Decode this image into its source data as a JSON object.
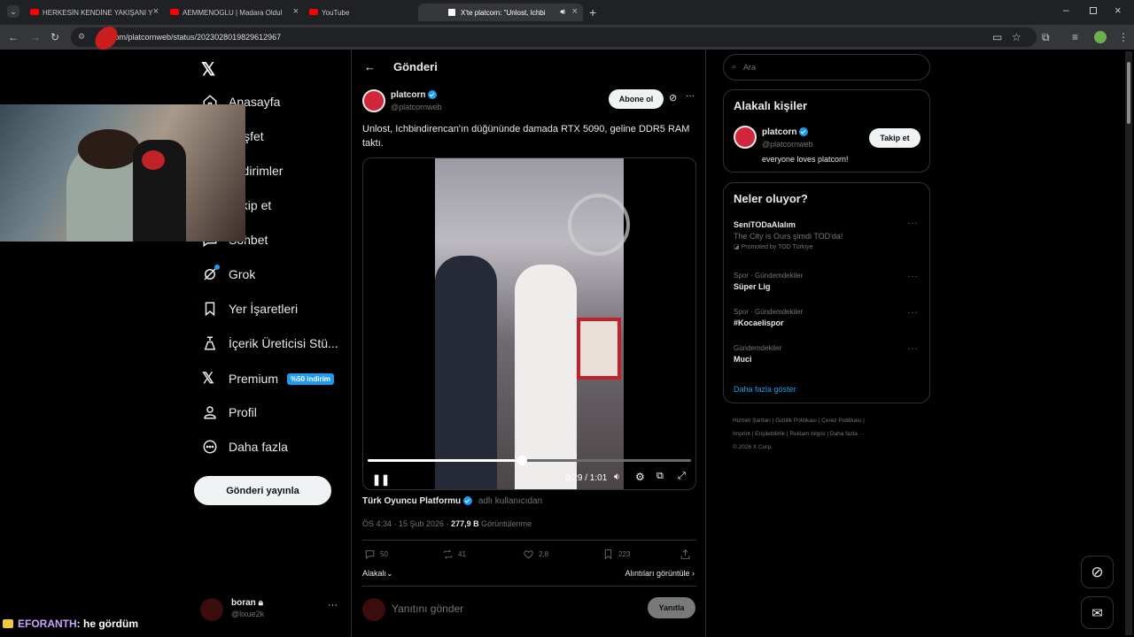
{
  "browser": {
    "tabs": [
      {
        "title": "HERKESİN KENDİNE YAKIŞANI Y"
      },
      {
        "title": "AEMMENOGLU | Madara Oldul"
      },
      {
        "title": "YouTube"
      },
      {
        "title": "X'te platcorn: \"Unlost, Ichbi"
      }
    ],
    "url": "x.com/platcornweb/status/2023028019829612967"
  },
  "sidebar": {
    "items": [
      {
        "label": "Anasayfa",
        "icon": "home-icon"
      },
      {
        "label": "Keşfet",
        "icon": "search-icon"
      },
      {
        "label": "Bildirimler",
        "icon": "bell-icon"
      },
      {
        "label": "Takip et",
        "icon": "follow-icon"
      },
      {
        "label": "Sohbet",
        "icon": "chat-icon"
      },
      {
        "label": "Grok",
        "icon": "grok-icon"
      },
      {
        "label": "Yer İşaretleri",
        "icon": "bookmark-icon"
      },
      {
        "label": "İçerik Üreticisi Stü...",
        "icon": "creator-studio-icon"
      },
      {
        "label": "Premium",
        "icon": "x-logo-icon",
        "badge": "%50 indirim"
      },
      {
        "label": "Profil",
        "icon": "profile-icon"
      },
      {
        "label": "Daha fazla",
        "icon": "more-circle-icon"
      }
    ],
    "post_button": "Gönderi yayınla",
    "account": {
      "name": "boran",
      "handle": "@lixue2k"
    }
  },
  "post": {
    "header": "Gönderi",
    "author": "platcorn",
    "handle": "@platcornweb",
    "subscribe": "Abone ol",
    "text": "Unlost, Ichbindirencan'ın düğününde damada RTX 5090, geline DDR5 RAM taktı.",
    "video": {
      "time": "0:29 / 1:01",
      "progress": 0.477
    },
    "attribution_name": "Türk Oyuncu Platformu",
    "attribution_suffix": "adlı kullanıcıdan",
    "timestamp": "ÖS 4:34 · 15 Şub 2026 · ",
    "views": "277,9 B",
    "views_label": " Görüntülenme",
    "stats": {
      "replies": "50",
      "reposts": "41",
      "likes": "2,8",
      "bookmarks": "223"
    },
    "relevance": "Alakalı",
    "quotes": "Alıntıları görüntüle",
    "reply_placeholder": "Yanıtını gönder",
    "reply_button": "Yanıtla"
  },
  "right": {
    "search_placeholder": "Ara",
    "related": {
      "title": "Alakalı kişiler",
      "name": "platcorn",
      "handle": "@platcornweb",
      "bio": "everyone loves platcorn!",
      "follow": "Takip et"
    },
    "trends": {
      "title": "Neler oluyor?",
      "items": [
        {
          "meta": "",
          "name": "SeniTODaAlalım",
          "desc": "The City is Ours şimdi TOD'da!",
          "promo": "Promoted by TOD Türkiye"
        },
        {
          "meta": "Spor · Gündemdekiler",
          "name": "Süper Lig"
        },
        {
          "meta": "Spor · Gündemdekiler",
          "name": "#Kocaelispor"
        },
        {
          "meta": "Gündemdekiler",
          "name": "Muci"
        }
      ],
      "more": "Daha fazla göster"
    },
    "footer": {
      "line1": "Hizmet Şartları  |  Gizlilik Politikası  |  Çerez Politikası  |",
      "line2": "Imprint  |  Erişilebilirlik  |  Reklam bilgisi  |  Daha fazla ···",
      "line3": "© 2026 X Corp."
    }
  },
  "overlay": {
    "chat_user": "EFORANTH",
    "chat_msg": ": he gördüm"
  },
  "colors": {
    "accent": "#1d9bf0",
    "youtube_red": "#ff0000"
  }
}
